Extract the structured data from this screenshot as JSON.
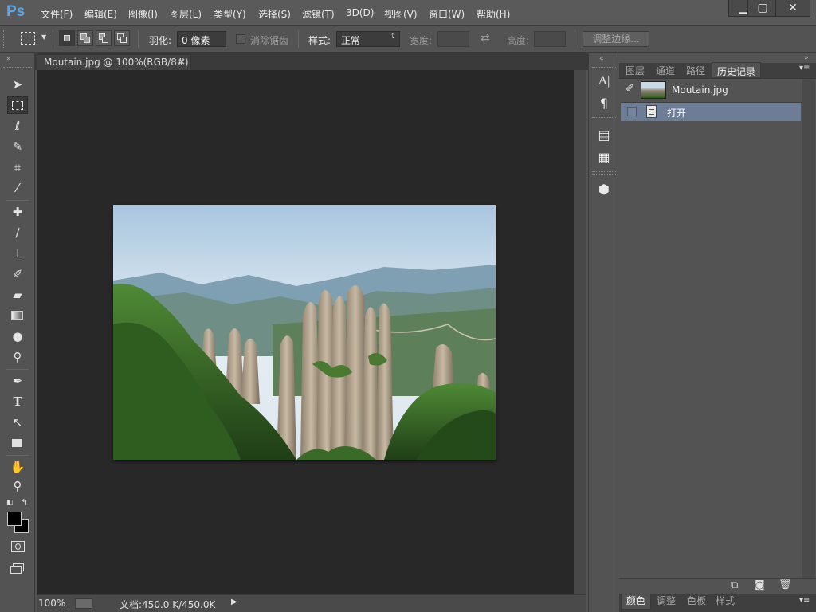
{
  "app": {
    "logo": "Ps"
  },
  "menu": [
    "文件(F)",
    "编辑(E)",
    "图像(I)",
    "图层(L)",
    "类型(Y)",
    "选择(S)",
    "滤镜(T)",
    "3D(D)",
    "视图(V)",
    "窗口(W)",
    "帮助(H)"
  ],
  "window_controls": {
    "minimize": "▁",
    "maximize": "▢",
    "close": "✕"
  },
  "options": {
    "feather_label": "羽化:",
    "feather_value": "0 像素",
    "antialias_label": "消除锯齿",
    "style_label": "样式:",
    "style_value": "正常",
    "width_label": "宽度:",
    "height_label": "高度:",
    "refine_edge_button": "调整边缘..."
  },
  "document": {
    "tab_title": "Moutain.jpg @ 100%(RGB/8#)",
    "tab_close": "×"
  },
  "status": {
    "zoom": "100%",
    "doc_info": "文档:450.0 K/450.0K",
    "menu_arrow": "▶"
  },
  "panel": {
    "tabs": [
      "图层",
      "通道",
      "路径",
      "历史记录"
    ],
    "active_tab": "历史记录",
    "snapshot_name": "Moutain.jpg",
    "history_items": [
      "打开"
    ],
    "bottom_tabs": [
      "颜色",
      "调整",
      "色板",
      "样式"
    ],
    "active_bottom_tab": "颜色"
  },
  "colors": {
    "selection_highlight": "#6e7d96",
    "ps_logo": "#5ca7e8",
    "canvas_background": "#282828",
    "foreground_swatch": "#000000",
    "background_swatch": "#000000"
  }
}
